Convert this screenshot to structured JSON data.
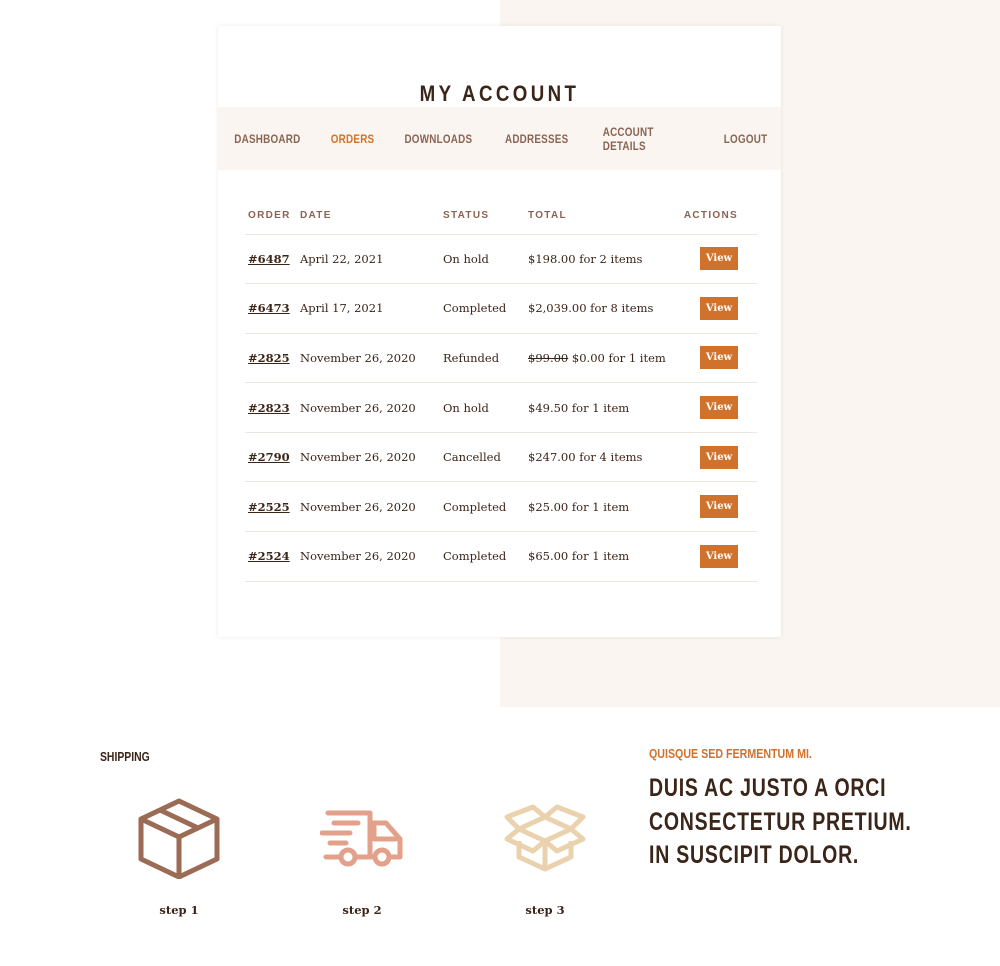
{
  "account": {
    "title": "MY ACCOUNT",
    "nav": [
      {
        "label": "DASHBOARD",
        "active": false
      },
      {
        "label": "ORDERS",
        "active": true
      },
      {
        "label": "DOWNLOADS",
        "active": false
      },
      {
        "label": "ADDRESSES",
        "active": false
      },
      {
        "label": "ACCOUNT DETAILS",
        "active": false
      },
      {
        "label": "LOGOUT",
        "active": false
      }
    ]
  },
  "orders": {
    "columns": [
      "ORDER",
      "DATE",
      "STATUS",
      "TOTAL",
      "ACTIONS"
    ],
    "view_label": "View",
    "rows": [
      {
        "order": "#6487",
        "date": "April 22, 2021",
        "status": "On hold",
        "original_total": "",
        "total": "$198.00 for 2 items"
      },
      {
        "order": "#6473",
        "date": "April 17, 2021",
        "status": "Completed",
        "original_total": "",
        "total": "$2,039.00 for 8 items"
      },
      {
        "order": "#2825",
        "date": "November 26, 2020",
        "status": "Refunded",
        "original_total": "$99.00",
        "total": "$0.00 for 1 item"
      },
      {
        "order": "#2823",
        "date": "November 26, 2020",
        "status": "On hold",
        "original_total": "",
        "total": "$49.50 for 1 item"
      },
      {
        "order": "#2790",
        "date": "November 26, 2020",
        "status": "Cancelled",
        "original_total": "",
        "total": "$247.00 for 4 items"
      },
      {
        "order": "#2525",
        "date": "November 26, 2020",
        "status": "Completed",
        "original_total": "",
        "total": "$25.00 for 1 item"
      },
      {
        "order": "#2524",
        "date": "November 26, 2020",
        "status": "Completed",
        "original_total": "",
        "total": "$65.00 for 1 item"
      }
    ]
  },
  "shipping": {
    "label": "SHIPPING",
    "steps": [
      {
        "icon": "closed-box-icon",
        "label": "step 1",
        "color": "#9b6b55"
      },
      {
        "icon": "delivery-truck-icon",
        "label": "step 2",
        "color": "#e3a08a"
      },
      {
        "icon": "open-box-icon",
        "label": "step 3",
        "color": "#e9d2ad"
      }
    ]
  },
  "promo": {
    "kicker": "QUISQUE SED FERMENTUM MI.",
    "heading_lines": [
      "DUIS AC JUSTO A ORCI",
      "CONSECTETUR PRETIUM.",
      "IN SUSCIPIT DOLOR."
    ]
  },
  "colors": {
    "accent": "#d0722b",
    "text_dark": "#3b2418",
    "text_muted": "#8a6452",
    "beige": "#faf5f0"
  }
}
